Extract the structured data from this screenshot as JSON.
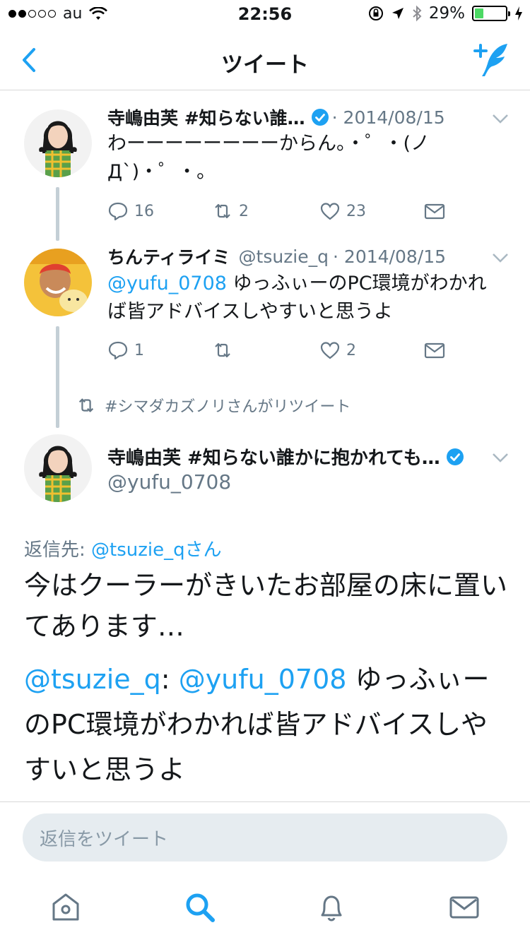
{
  "status_bar": {
    "carrier": "au",
    "time": "22:56",
    "battery_text": "29%",
    "battery_level": 0.29,
    "signal_dots_filled": 2,
    "signal_dots_total": 5
  },
  "nav": {
    "title": "ツイート",
    "back_icon": "chevron-left-icon",
    "compose_icon": "compose-tweet-icon"
  },
  "tweets": [
    {
      "name": "寺嶋由芙 #知らない誰…",
      "date": "· 2014/08/15",
      "text": "わーーーーーーーーからん。・゜・(ノД`)・゜・。",
      "replies": "16",
      "retweets": "2",
      "likes": "23"
    },
    {
      "name": "ちんティライミ",
      "handle": "@tsuzie_q",
      "date": "· 2014/08/15",
      "mention": "@yufu_0708",
      "text": " ゆっふぃーのPC環境がわかれば皆アドバイスしやすいと思うよ",
      "replies": "1",
      "retweets": "",
      "likes": "2"
    }
  ],
  "retweet_notice": "#シマダカズノリさんがリツイート",
  "focus": {
    "name": "寺嶋由芙 #知らない誰かに抱かれても…",
    "handle": "@yufu_0708",
    "reply_prefix": "返信先: ",
    "reply_target": "@tsuzie_qさん",
    "text": "今はクーラーがきいたお部屋の床に置いてあります…",
    "quote_handle": "@tsuzie_q",
    "quote_colon": ": ",
    "quote_mention": "@yufu_0708",
    "quote_text": " ゆっふぃーのPC環境がわかれば皆アドバイスしやすいと思うよ"
  },
  "reply_placeholder": "返信をツイート",
  "colors": {
    "accent": "#1da1f2",
    "secondary_text": "#657786",
    "thread_line": "#c4cfd6",
    "battery": "#4cd964"
  },
  "tabs": [
    "home-icon",
    "search-icon",
    "notifications-icon",
    "messages-icon"
  ]
}
